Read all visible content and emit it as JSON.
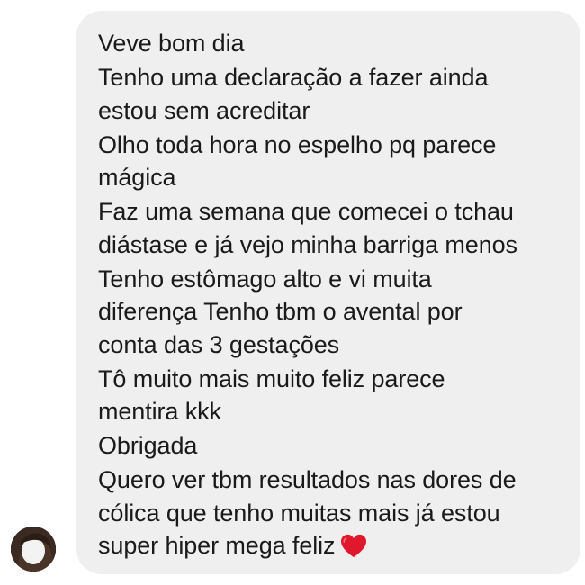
{
  "message": {
    "lines": [
      "Veve bom dia",
      "Tenho uma declaração a fazer ainda",
      "estou sem acreditar",
      "Olho toda hora no espelho pq parece",
      "mágica",
      "Faz uma semana que comecei o tchau",
      "diástase e já vejo minha barriga menos",
      "Tenho estômago alto e vi muita",
      "diferença Tenho tbm o avental por",
      "conta das 3 gestações",
      "Tô muito mais muito feliz parece",
      "mentira kkk",
      "Obrigada",
      "Quero ver tbm resultados nas dores de",
      "cólica que tenho muitas mais já estou",
      "super hiper mega feliz"
    ],
    "emoji": "red-heart-icon"
  },
  "colors": {
    "bubble": "#efefef",
    "text": "#1a1a1a",
    "heart": "#e0182d"
  }
}
